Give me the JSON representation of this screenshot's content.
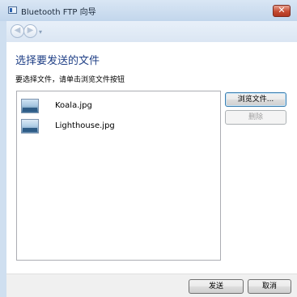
{
  "window": {
    "title": "Bluetooth FTP 向导",
    "close_glyph": "✕",
    "back_glyph": "◀",
    "forward_glyph": "▶",
    "history_glyph": "▾"
  },
  "main": {
    "heading": "选择要发送的文件",
    "instruction": "要选择文件，请单击浏览文件按钮",
    "files": [
      {
        "name": "Koala.jpg",
        "icon": "image-icon"
      },
      {
        "name": "Lighthouse.jpg",
        "icon": "image-icon"
      }
    ],
    "browse_label": "浏览文件...",
    "delete_label": "删除"
  },
  "footer": {
    "send_label": "发送",
    "cancel_label": "取消"
  },
  "colors": {
    "frame": "#cfdff0",
    "heading": "#1f3f86",
    "close_button": "#c54a31"
  }
}
